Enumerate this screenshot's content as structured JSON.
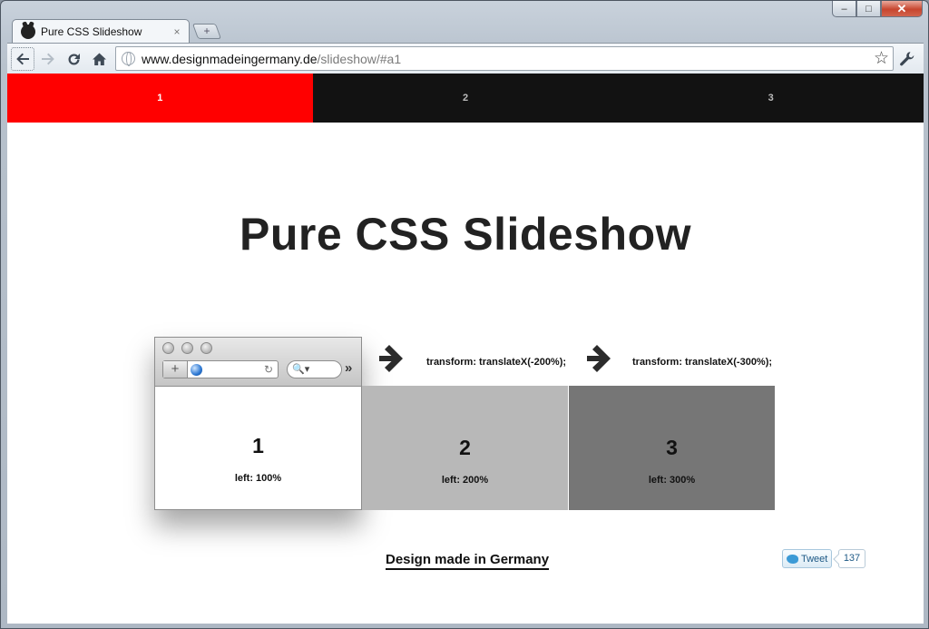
{
  "browser": {
    "tab_title": "Pure CSS Slideshow",
    "tab_close": "×",
    "new_tab": "+",
    "url_host": "www.designmadeingermany.de",
    "url_path": "/slideshow/#a1",
    "caption": {
      "minimize": "–",
      "maximize": "□",
      "close": "✕"
    },
    "icons": {
      "back": "back-arrow-icon",
      "forward": "forward-arrow-icon",
      "reload": "reload-icon",
      "home": "home-icon",
      "star": "star-icon",
      "wrench": "wrench-icon"
    }
  },
  "page": {
    "slide_nav": [
      {
        "label": "1",
        "active": true
      },
      {
        "label": "2",
        "active": false
      },
      {
        "label": "3",
        "active": false
      }
    ],
    "title": "Pure CSS Slideshow",
    "slides": [
      {
        "number": "1",
        "position": "left: 100%"
      },
      {
        "number": "2",
        "position": "left: 200%"
      },
      {
        "number": "3",
        "position": "left: 300%"
      }
    ],
    "transforms": [
      "transform: translateX(-200%);",
      "transform: translateX(-300%);"
    ],
    "mini_browser": {
      "plus": "+",
      "search_glyph": "🔍▾",
      "more": "»",
      "refresh": "↻"
    },
    "footer_link": "Design made in Germany",
    "tweet": {
      "label": "Tweet",
      "count": "137"
    },
    "colors": {
      "active_nav": "#ff0000",
      "nav_bg": "#121212",
      "slide2": "#b8b8b8",
      "slide3": "#767676"
    }
  }
}
